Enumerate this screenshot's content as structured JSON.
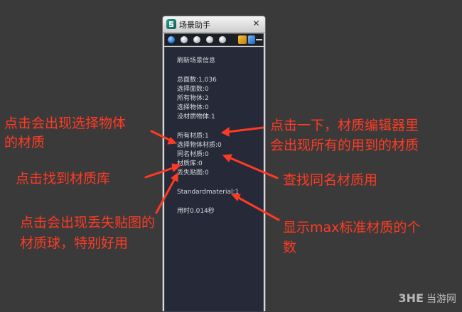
{
  "window": {
    "title": "场景助手",
    "close_label": "✕"
  },
  "panel": {
    "refresh": "刷新场景信息",
    "total_faces": "总面数:1,036",
    "selected_faces": "选择面数:0",
    "all_objects": "所有物体:2",
    "selected_objects": "选择物体:0",
    "no_material_objects": "没材质物体:1",
    "all_materials": "所有材质:1",
    "selected_object_materials": "选择物体材质:0",
    "same_name_materials": "同名材质:0",
    "material_library": "材质库:0",
    "missing_maps": "丢失贴图:0",
    "standard_material": "Standardmaterial:1",
    "time_used": "用时0.014秒"
  },
  "annotations": {
    "select_objects_line1": "点击会出现选择物体",
    "select_objects_line2": "的材质",
    "all_materials_line1": "点击一下，材质编辑器里",
    "all_materials_line2": "会出现所有的用到的材质",
    "find_library": "点击找到材质库",
    "find_same_name": "查找同名材质用",
    "missing_maps_line1": "点击会出现丢失贴图的",
    "missing_maps_line2": "材质球，特别好用",
    "standard_count_line1": "显示max标准材质的个",
    "standard_count_line2": "数"
  },
  "watermark": {
    "logo": "3HE",
    "site": "当游网"
  },
  "colors": {
    "annotation": "#ff3a24",
    "panel_bg": "#262a38",
    "panel_text": "#d6d8dc",
    "background": "#3a3a3a"
  }
}
